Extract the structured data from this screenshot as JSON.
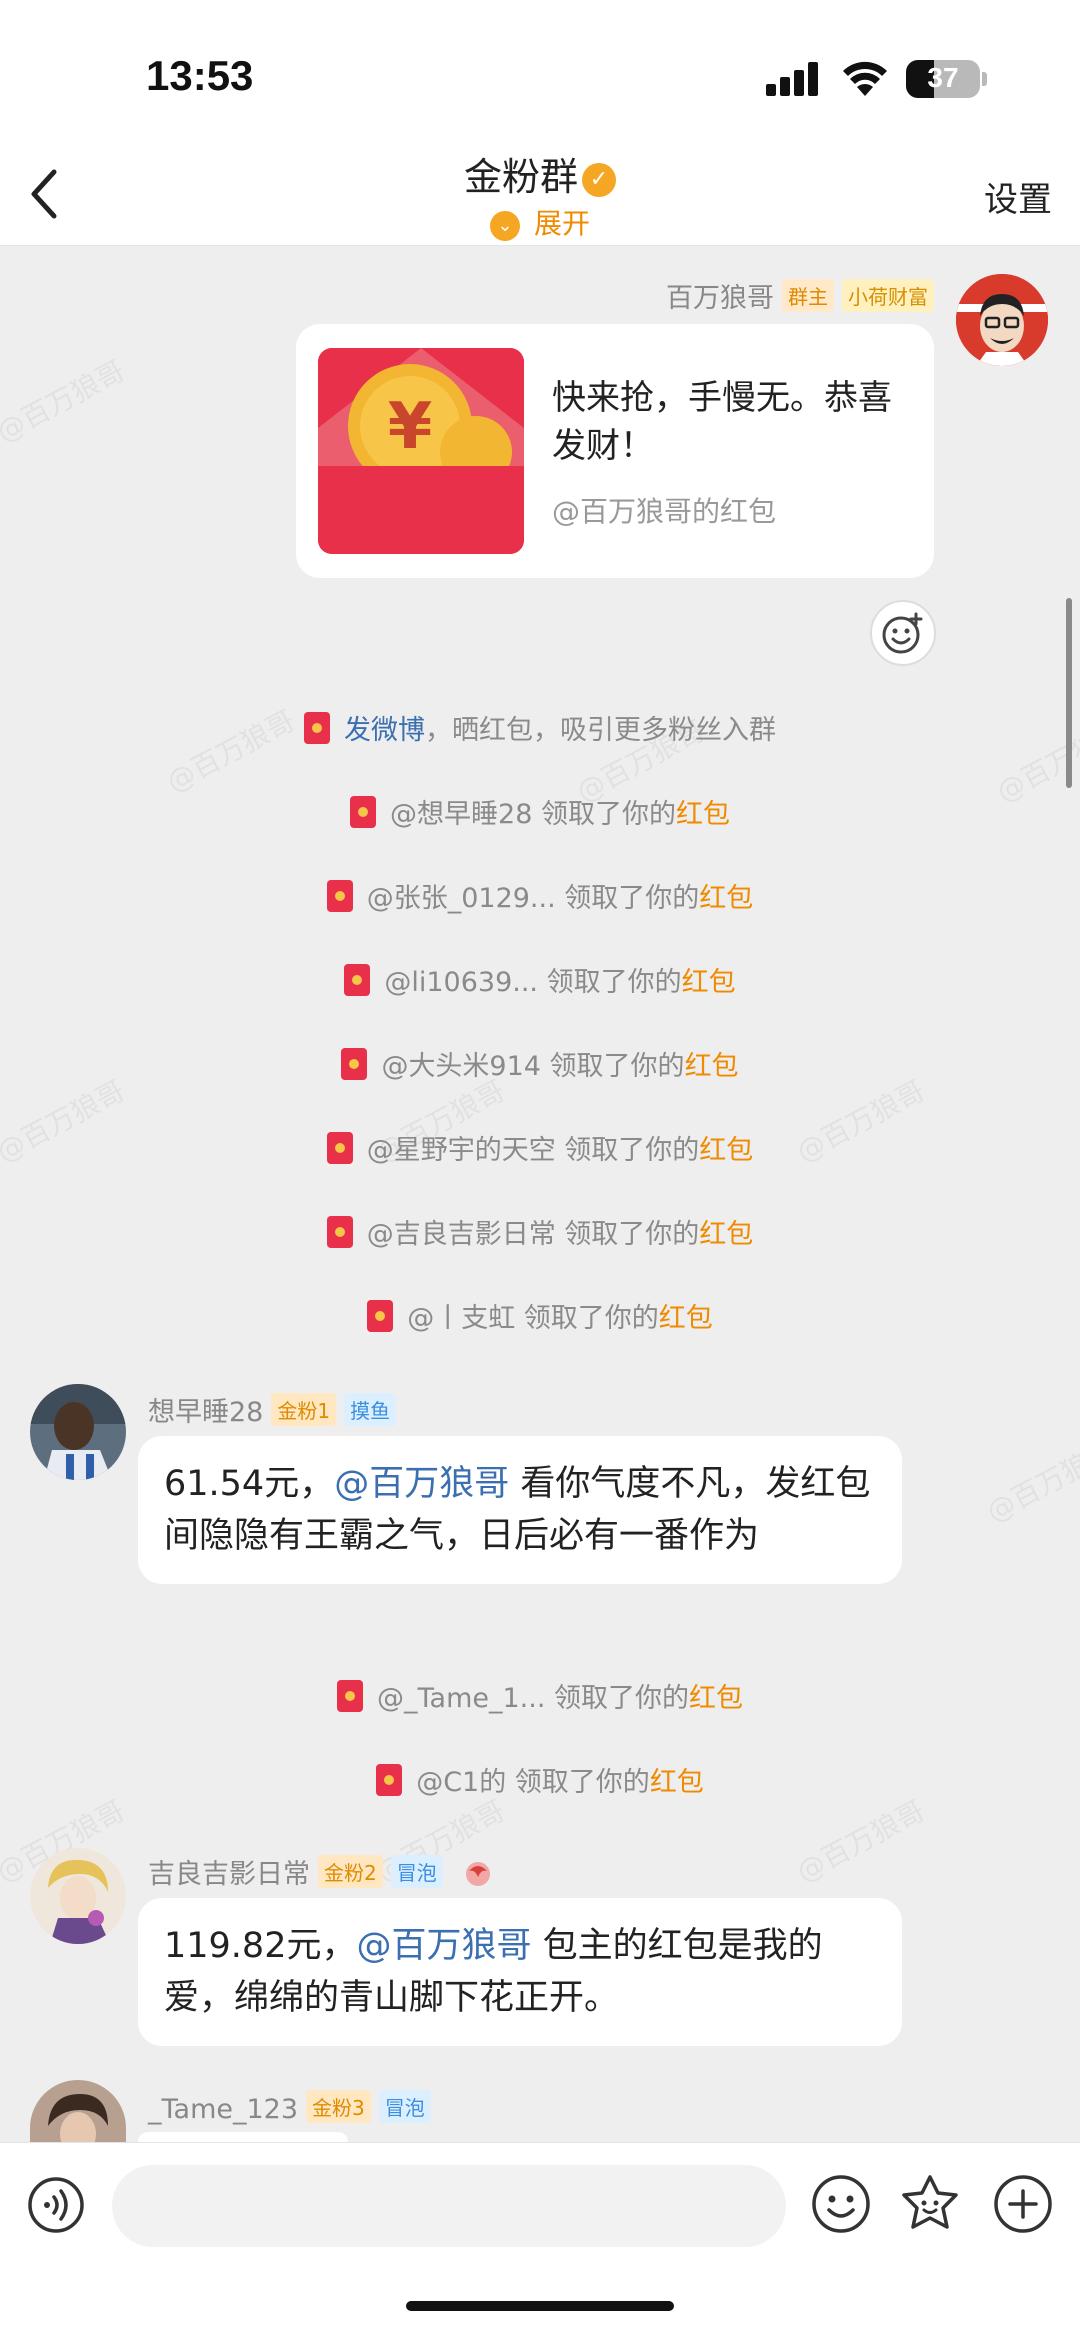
{
  "status": {
    "time": "13:53",
    "battery": "37"
  },
  "nav": {
    "title": "金粉群",
    "verified_icon": "check-badge",
    "expand_label": "展开",
    "settings_label": "设置"
  },
  "watermark": "@百万狼哥",
  "owner_message": {
    "sender": "百万狼哥",
    "tag_owner": "群主",
    "tag_title": "小荷财富",
    "red_packet_text": "快来抢，手慢无。恭喜发财！",
    "red_packet_from": "@百万狼哥的红包"
  },
  "system_rows": [
    {
      "link": "发微博",
      "text": "，晒红包，吸引更多粉丝入群",
      "hl": ""
    },
    {
      "link": "",
      "text": "@想早睡28 领取了你的",
      "hl": "红包"
    },
    {
      "link": "",
      "text": "@张张_0129... 领取了你的",
      "hl": "红包"
    },
    {
      "link": "",
      "text": "@li10639... 领取了你的",
      "hl": "红包"
    },
    {
      "link": "",
      "text": "@大头米914 领取了你的",
      "hl": "红包"
    },
    {
      "link": "",
      "text": "@星野宇的天空 领取了你的",
      "hl": "红包"
    },
    {
      "link": "",
      "text": "@吉良吉影日常 领取了你的",
      "hl": "红包"
    },
    {
      "link": "",
      "text": "@丨支虹 领取了你的",
      "hl": "红包"
    },
    {
      "link": "",
      "text": "@_Tame_1... 领取了你的",
      "hl": "红包"
    },
    {
      "link": "",
      "text": "@C1的 领取了你的",
      "hl": "红包"
    }
  ],
  "messages": [
    {
      "name": "想早睡28",
      "fan_badge": "金粉1",
      "level_tag": "摸鱼",
      "amount": "61.54元，",
      "mention": "@百万狼哥",
      "text": " 看你气度不凡，发红包间隐隐有王霸之气，日后必有一番作为"
    },
    {
      "name": "吉良吉影日常",
      "fan_badge": "金粉2",
      "level_tag": "冒泡",
      "amount": "119.82元，",
      "mention": "@百万狼哥",
      "text": " 包主的红包是我的爱，绵绵的青山脚下花正开。"
    },
    {
      "name": "_Tame_123",
      "fan_badge": "金粉3",
      "level_tag": "冒泡"
    }
  ],
  "bottom": {
    "input_placeholder": ""
  },
  "colors": {
    "accent_orange": "#f08a00",
    "red_packet": "#e8304a",
    "mention_blue": "#3b6fb0",
    "background": "#eeeeee"
  }
}
